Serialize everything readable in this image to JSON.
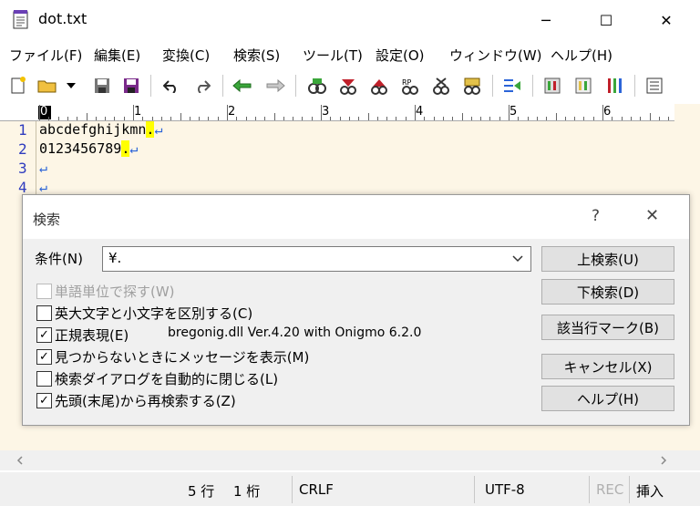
{
  "window": {
    "title": "dot.txt",
    "minimize": "─",
    "maximize": "☐",
    "close": "✕"
  },
  "menu": [
    "ファイル(F)",
    "編集(E)",
    "変換(C)",
    "検索(S)",
    "ツール(T)",
    "設定(O)",
    "ウィンドウ(W)",
    "ヘルプ(H)"
  ],
  "ruler": [
    "0",
    "1",
    "2",
    "3",
    "4",
    "5",
    "6"
  ],
  "editor": {
    "line_numbers": [
      "1",
      "2",
      "3",
      "4"
    ],
    "lines": [
      {
        "text": "abcdefghijkmn",
        "match": ".",
        "eol": "↵"
      },
      {
        "text": "0123456789",
        "match": ".",
        "eol": "↵"
      },
      {
        "text": "",
        "match": "",
        "eol": "↵"
      },
      {
        "text": "",
        "match": "",
        "eol": "↵"
      }
    ]
  },
  "dialog": {
    "title": "検索",
    "help": "?",
    "close": "✕",
    "condition_label": "条件(N)",
    "condition_value": "¥.",
    "regex_library": "bregonig.dll Ver.4.20 with Onigmo 6.2.0",
    "options": [
      {
        "label": "単語単位で探す(W)",
        "checked": false,
        "disabled": true
      },
      {
        "label": "英大文字と小文字を区別する(C)",
        "checked": false,
        "disabled": false
      },
      {
        "label": "正規表現(E)",
        "checked": true,
        "disabled": false
      },
      {
        "label": "見つからないときにメッセージを表示(M)",
        "checked": true,
        "disabled": false
      },
      {
        "label": "検索ダイアログを自動的に閉じる(L)",
        "checked": false,
        "disabled": false
      },
      {
        "label": "先頭(末尾)から再検索する(Z)",
        "checked": true,
        "disabled": false
      }
    ],
    "buttons": {
      "search_up": "上検索(U)",
      "search_down": "下検索(D)",
      "mark_lines": "該当行マーク(B)",
      "cancel": "キャンセル(X)",
      "help_btn": "ヘルプ(H)"
    }
  },
  "status": {
    "row": "5 行",
    "col": "1 桁",
    "eol": "CRLF",
    "encoding": "UTF-8",
    "rec": "REC",
    "mode": "挿入"
  },
  "colors": {
    "editor_bg": "#fdf6e6",
    "line_number": "#2f3cbf",
    "match_highlight": "#ffff00"
  }
}
